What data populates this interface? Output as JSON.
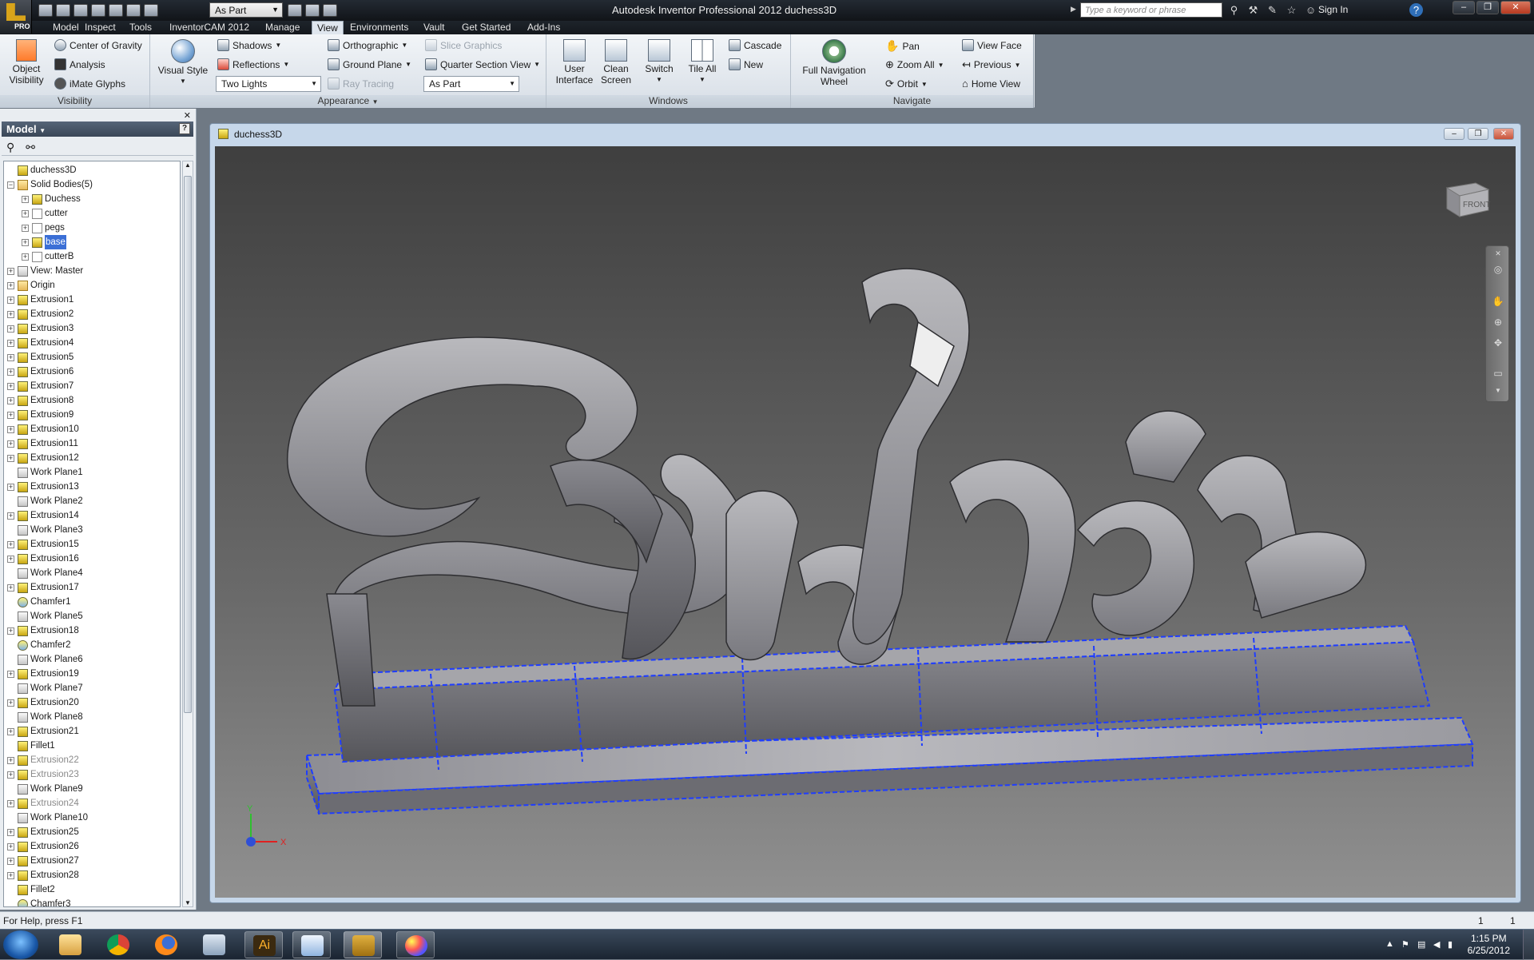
{
  "app": {
    "title": "Autodesk Inventor Professional 2012   duchess3D",
    "pro_badge": "PRO",
    "appearance_combo": "As Part",
    "search_placeholder": "Type a keyword or phrase",
    "sign_in": "Sign In"
  },
  "tabs": [
    "Model",
    "Inspect",
    "Tools",
    "InventorCAM 2012",
    "Manage",
    "View",
    "Environments",
    "Vault",
    "Get Started",
    "Add-Ins"
  ],
  "active_tab": "View",
  "ribbon": {
    "visibility": {
      "label": "Visibility",
      "object_visibility": "Object\nVisibility",
      "object_visibility_l1": "Object",
      "object_visibility_l2": "Visibility",
      "center_of_gravity": "Center of Gravity",
      "analysis": "Analysis",
      "imate_glyphs": "iMate Glyphs"
    },
    "appearance": {
      "label": "Appearance",
      "visual_style_l1": "Visual Style",
      "shadows": "Shadows",
      "reflections": "Reflections",
      "lights_combo": "Two Lights",
      "orthographic": "Orthographic",
      "ground_plane": "Ground Plane",
      "ray_tracing": "Ray Tracing",
      "slice_graphics": "Slice Graphics",
      "quarter_section_view": "Quarter Section View",
      "as_part_combo": "As Part"
    },
    "windows": {
      "label": "Windows",
      "user_interface_l1": "User",
      "user_interface_l2": "Interface",
      "clean_screen_l1": "Clean",
      "clean_screen_l2": "Screen",
      "switch": "Switch",
      "tile_all": "Tile All",
      "cascade": "Cascade",
      "new": "New"
    },
    "navigate": {
      "label": "Navigate",
      "full_nav_l1": "Full Navigation",
      "full_nav_l2": "Wheel",
      "pan": "Pan",
      "zoom_all": "Zoom All",
      "orbit": "Orbit",
      "view_face": "View Face",
      "previous": "Previous",
      "home_view": "Home View"
    }
  },
  "browser": {
    "header": "Model",
    "items": [
      {
        "label": "duchess3D",
        "level": 0,
        "icon": "part",
        "exp": false
      },
      {
        "label": "Solid Bodies(5)",
        "level": 0,
        "icon": "bodies",
        "exp": true,
        "open": true
      },
      {
        "label": "Duchess",
        "level": 1,
        "icon": "part",
        "exp": true
      },
      {
        "label": "cutter",
        "level": 1,
        "icon": "body",
        "exp": true
      },
      {
        "label": "pegs",
        "level": 1,
        "icon": "body",
        "exp": true
      },
      {
        "label": "base",
        "level": 1,
        "icon": "part",
        "exp": true,
        "selected": true
      },
      {
        "label": "cutterB",
        "level": 1,
        "icon": "body",
        "exp": true
      },
      {
        "label": "View: Master",
        "level": 0,
        "icon": "view",
        "exp": true
      },
      {
        "label": "Origin",
        "level": 0,
        "icon": "folder",
        "exp": true
      },
      {
        "label": "Extrusion1",
        "level": 0,
        "icon": "part",
        "exp": true
      },
      {
        "label": "Extrusion2",
        "level": 0,
        "icon": "part",
        "exp": true
      },
      {
        "label": "Extrusion3",
        "level": 0,
        "icon": "part",
        "exp": true
      },
      {
        "label": "Extrusion4",
        "level": 0,
        "icon": "part",
        "exp": true
      },
      {
        "label": "Extrusion5",
        "level": 0,
        "icon": "part",
        "exp": true
      },
      {
        "label": "Extrusion6",
        "level": 0,
        "icon": "part",
        "exp": true
      },
      {
        "label": "Extrusion7",
        "level": 0,
        "icon": "part",
        "exp": true
      },
      {
        "label": "Extrusion8",
        "level": 0,
        "icon": "part",
        "exp": true
      },
      {
        "label": "Extrusion9",
        "level": 0,
        "icon": "part",
        "exp": true
      },
      {
        "label": "Extrusion10",
        "level": 0,
        "icon": "part",
        "exp": true
      },
      {
        "label": "Extrusion11",
        "level": 0,
        "icon": "part",
        "exp": true
      },
      {
        "label": "Extrusion12",
        "level": 0,
        "icon": "part",
        "exp": true
      },
      {
        "label": "Work Plane1",
        "level": 0,
        "icon": "wp",
        "exp": false
      },
      {
        "label": "Extrusion13",
        "level": 0,
        "icon": "part",
        "exp": true
      },
      {
        "label": "Work Plane2",
        "level": 0,
        "icon": "wp",
        "exp": false
      },
      {
        "label": "Extrusion14",
        "level": 0,
        "icon": "part",
        "exp": true
      },
      {
        "label": "Work Plane3",
        "level": 0,
        "icon": "wp",
        "exp": false
      },
      {
        "label": "Extrusion15",
        "level": 0,
        "icon": "part",
        "exp": true
      },
      {
        "label": "Extrusion16",
        "level": 0,
        "icon": "part",
        "exp": true
      },
      {
        "label": "Work Plane4",
        "level": 0,
        "icon": "wp",
        "exp": false
      },
      {
        "label": "Extrusion17",
        "level": 0,
        "icon": "part",
        "exp": true
      },
      {
        "label": "Chamfer1",
        "level": 0,
        "icon": "ch",
        "exp": false
      },
      {
        "label": "Work Plane5",
        "level": 0,
        "icon": "wp",
        "exp": false
      },
      {
        "label": "Extrusion18",
        "level": 0,
        "icon": "part",
        "exp": true
      },
      {
        "label": "Chamfer2",
        "level": 0,
        "icon": "ch",
        "exp": false
      },
      {
        "label": "Work Plane6",
        "level": 0,
        "icon": "wp",
        "exp": false
      },
      {
        "label": "Extrusion19",
        "level": 0,
        "icon": "part",
        "exp": true
      },
      {
        "label": "Work Plane7",
        "level": 0,
        "icon": "wp",
        "exp": false
      },
      {
        "label": "Extrusion20",
        "level": 0,
        "icon": "part",
        "exp": true
      },
      {
        "label": "Work Plane8",
        "level": 0,
        "icon": "wp",
        "exp": false
      },
      {
        "label": "Extrusion21",
        "level": 0,
        "icon": "part",
        "exp": true
      },
      {
        "label": "Fillet1",
        "level": 0,
        "icon": "part",
        "exp": false
      },
      {
        "label": "Extrusion22",
        "level": 0,
        "icon": "part",
        "exp": true,
        "grey": true
      },
      {
        "label": "Extrusion23",
        "level": 0,
        "icon": "part",
        "exp": true,
        "grey": true
      },
      {
        "label": "Work Plane9",
        "level": 0,
        "icon": "wp",
        "exp": false
      },
      {
        "label": "Extrusion24",
        "level": 0,
        "icon": "part",
        "exp": true,
        "grey": true
      },
      {
        "label": "Work Plane10",
        "level": 0,
        "icon": "wp",
        "exp": false
      },
      {
        "label": "Extrusion25",
        "level": 0,
        "icon": "part",
        "exp": true
      },
      {
        "label": "Extrusion26",
        "level": 0,
        "icon": "part",
        "exp": true
      },
      {
        "label": "Extrusion27",
        "level": 0,
        "icon": "part",
        "exp": true
      },
      {
        "label": "Extrusion28",
        "level": 0,
        "icon": "part",
        "exp": true
      },
      {
        "label": "Fillet2",
        "level": 0,
        "icon": "part",
        "exp": false
      },
      {
        "label": "Chamfer3",
        "level": 0,
        "icon": "ch",
        "exp": false
      }
    ]
  },
  "document": {
    "title": "duchess3D",
    "viewcube_label": "FRONT",
    "triad_y": "Y",
    "triad_x": "X"
  },
  "status": {
    "help": "For Help, press F1",
    "count1": "1",
    "count2": "1"
  },
  "taskbar": {
    "time": "1:15 PM",
    "date": "6/25/2012"
  },
  "colors": {
    "selection_edges": "#1f3dff",
    "viewport_top": "#3f3f3f",
    "viewport_bottom": "#909090"
  }
}
